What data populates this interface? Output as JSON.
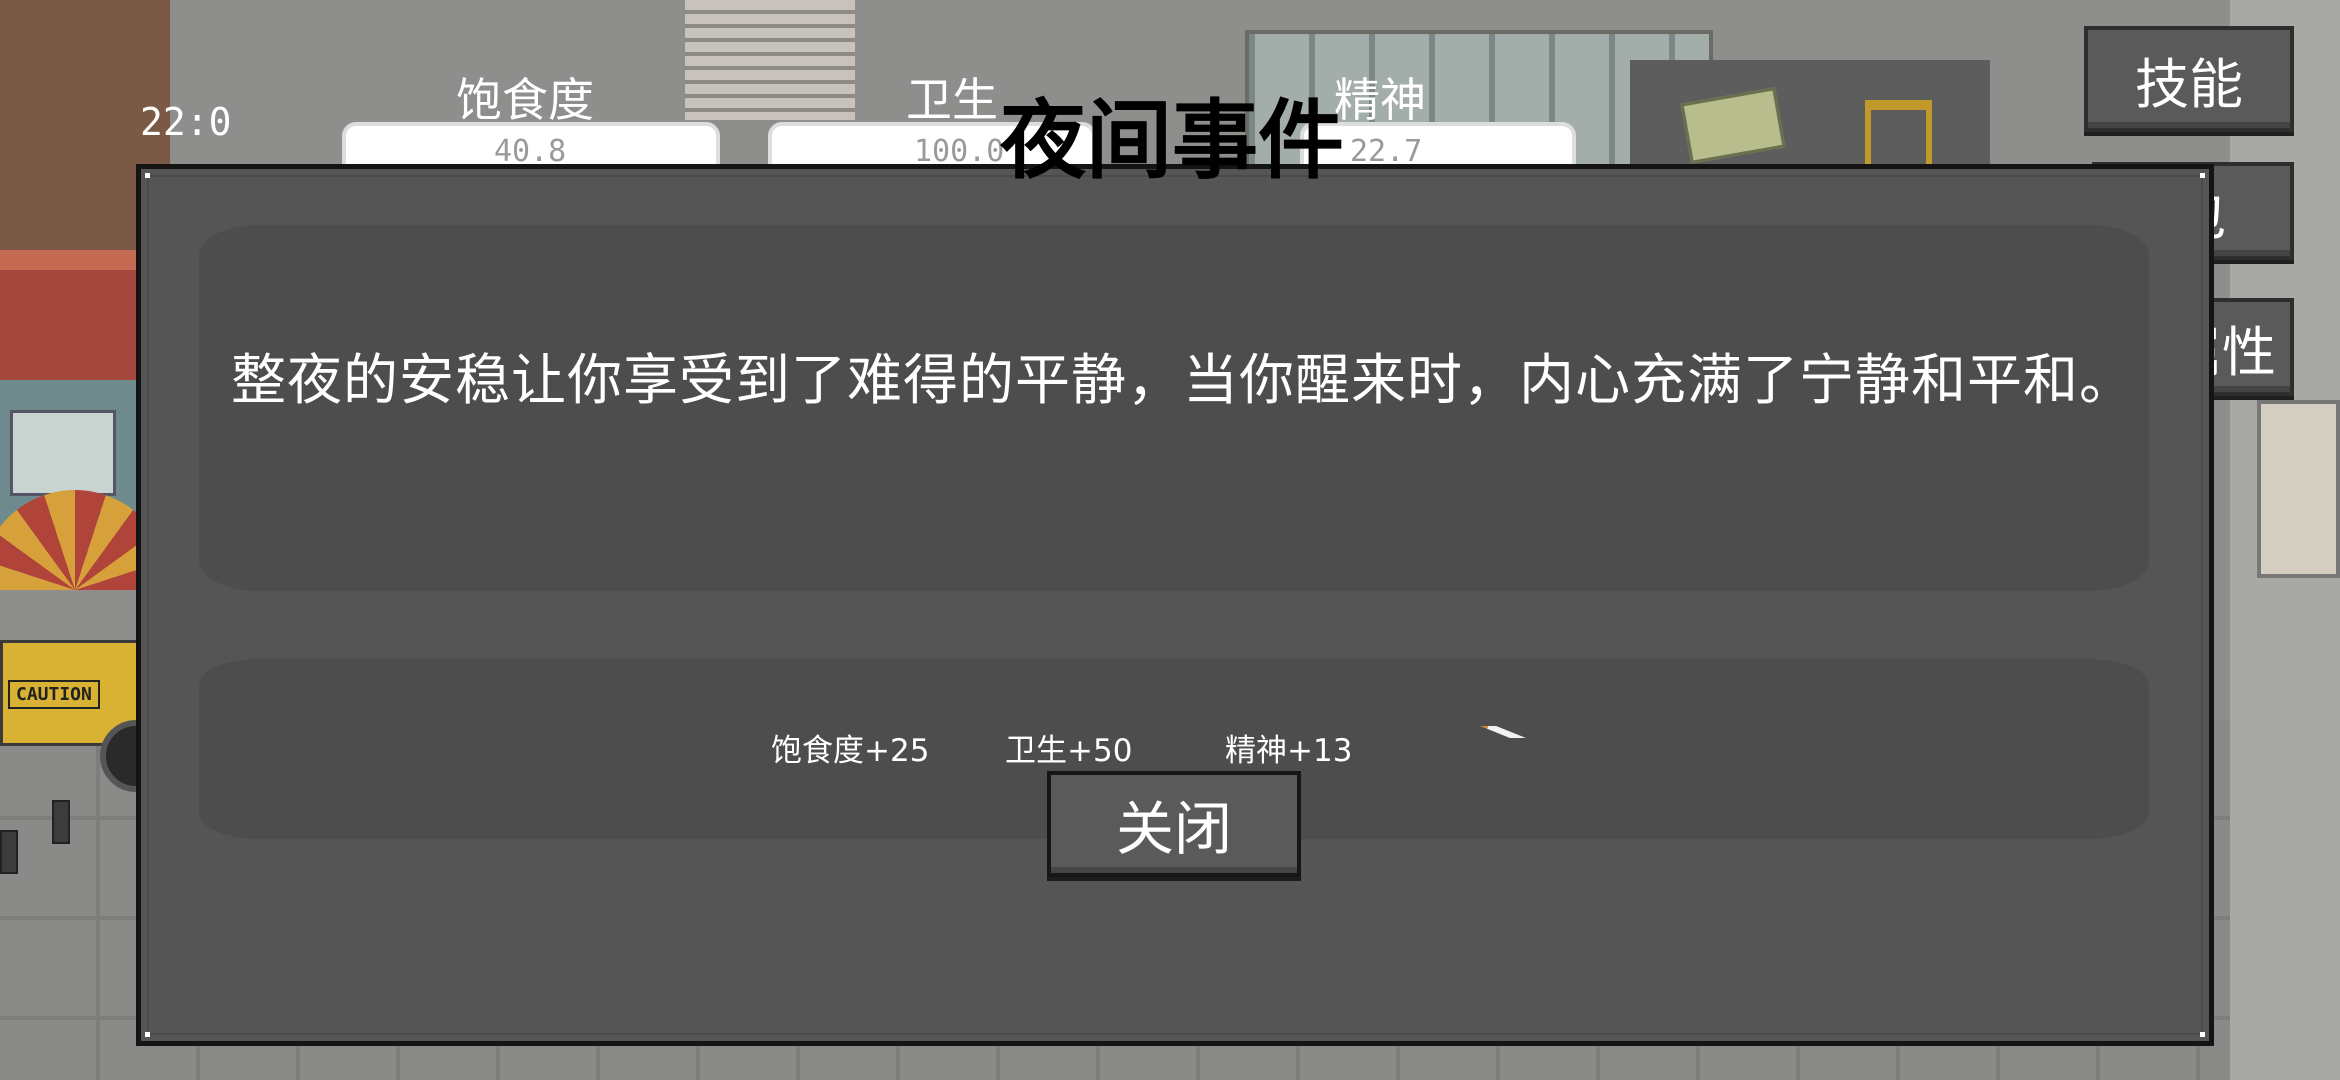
{
  "hud": {
    "time": "22:0",
    "stats": [
      {
        "label": "饱食度",
        "value": "40.8"
      },
      {
        "label": "卫生",
        "value": "100.0"
      },
      {
        "label": "精神",
        "value": "22.7"
      }
    ]
  },
  "side_menu": {
    "skills": "技能",
    "bag": "包",
    "attributes": "属性"
  },
  "background": {
    "sign_text": "CAUTION"
  },
  "modal": {
    "title": "夜间事件",
    "message": "整夜的安稳让你享受到了难得的平静，当你醒来时，内心充满了宁静和平和。",
    "rewards": [
      "饱食度+25",
      "卫生+50",
      "精神+13"
    ],
    "reward_item_icon": "cigarette-icon",
    "close_label": "关闭"
  },
  "colors": {
    "modal_bg": "#555555",
    "panel_bg": "#4d4d4d",
    "button_bg": "#5a5a5a",
    "text": "#ffffff"
  }
}
